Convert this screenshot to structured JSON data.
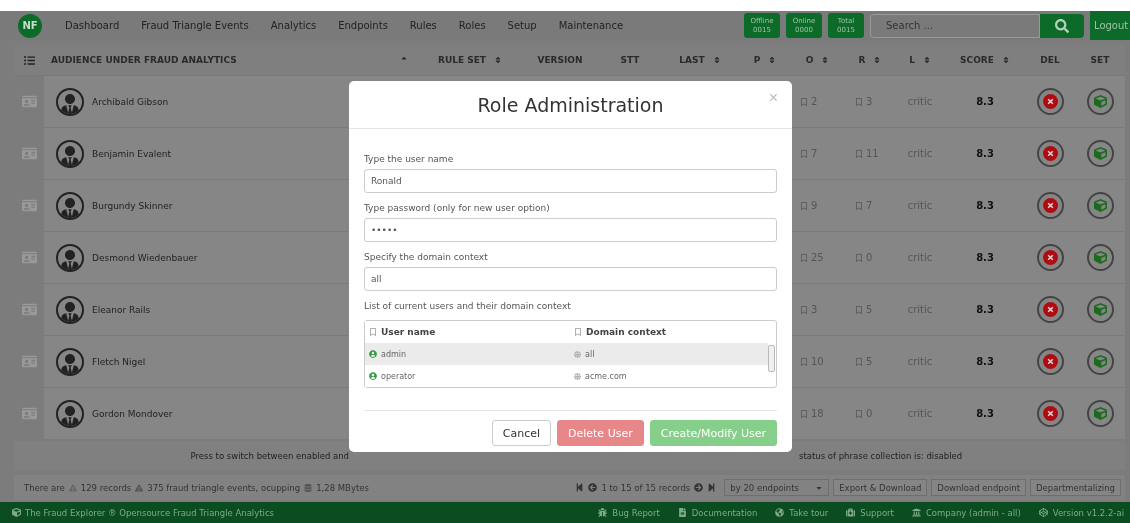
{
  "nav": {
    "logo": "NF",
    "items": [
      "Dashboard",
      "Fraud Triangle Events",
      "Analytics",
      "Endpoints",
      "Rules",
      "Roles",
      "Setup",
      "Maintenance"
    ],
    "counters": [
      {
        "label": "Offline",
        "value": "0015"
      },
      {
        "label": "Online",
        "value": "0000"
      },
      {
        "label": "Total",
        "value": "0015"
      }
    ],
    "search": {
      "placeholder": "Search ..."
    },
    "logout": "Logout"
  },
  "table": {
    "columns": [
      {
        "kind": "list"
      },
      {
        "label": "AUDIENCE UNDER FRAUD ANALYTICS",
        "kind": "sorted"
      },
      {
        "label": "RULE SET",
        "kind": "sortable"
      },
      {
        "label": "VERSION",
        "kind": "plain"
      },
      {
        "label": "STT",
        "kind": "plain"
      },
      {
        "label": "LAST",
        "kind": "sortable"
      },
      {
        "label": "P",
        "kind": "sortable"
      },
      {
        "label": "O",
        "kind": "sortable"
      },
      {
        "label": "R",
        "kind": "sortable"
      },
      {
        "label": "L",
        "kind": "sortable"
      },
      {
        "label": "SCORE",
        "kind": "sortable"
      },
      {
        "label": "DEL",
        "kind": "plain"
      },
      {
        "label": "SET",
        "kind": "plain"
      }
    ],
    "rows": [
      {
        "name": "Archibald Gibson",
        "o": "2",
        "r": "3",
        "l": "critic",
        "score": "8.3"
      },
      {
        "name": "Benjamin Evalent",
        "o": "7",
        "r": "11",
        "l": "critic",
        "score": "8.3"
      },
      {
        "name": "Burgundy Skinner",
        "o": "9",
        "r": "7",
        "l": "critic",
        "score": "8.3"
      },
      {
        "name": "Desmond Wiedenbauer",
        "o": "25",
        "r": "0",
        "l": "critic",
        "score": "8.3"
      },
      {
        "name": "Eleanor Rails",
        "o": "3",
        "r": "5",
        "l": "critic",
        "score": "8.3"
      },
      {
        "name": "Fletch Nigel",
        "o": "10",
        "r": "5",
        "l": "critic",
        "score": "8.3"
      },
      {
        "name": "Gordon Mondover",
        "o": "18",
        "r": "0",
        "l": "critic",
        "score": "8.3"
      }
    ]
  },
  "hint": {
    "left": "Press to switch between enabled and",
    "right": "status of phrase collection is: disabled"
  },
  "status": {
    "prefix": "There are",
    "records": "129 records",
    "events": "375 fraud triangle events, ocupping",
    "size": "1,28 MBytes",
    "pager": "1 to 15 of 15 records",
    "per_page": "by 20 endpoints",
    "buttons": [
      "Export & Download",
      "Download endpoint",
      "Departmentalizing"
    ]
  },
  "footer": {
    "brand": "The Fraud Explorer ® Opensource Fraud Triangle Analytics",
    "links": [
      {
        "kind": "bug",
        "label": "Bug Report"
      },
      {
        "kind": "doc",
        "label": "Documentation"
      },
      {
        "kind": "tour",
        "label": "Take tour"
      },
      {
        "kind": "support",
        "label": "Support"
      },
      {
        "kind": "company",
        "label": "Company (admin - all)"
      },
      {
        "kind": "version",
        "label": "Version v1.2.2-ai"
      }
    ]
  },
  "modal": {
    "title": "Role Administration",
    "close": "×",
    "fields": [
      {
        "label": "Type the user name",
        "value": "Ronald"
      },
      {
        "label": "Type password (only for new user option)",
        "value": "•••••"
      },
      {
        "label": "Specify the domain context",
        "value": "all"
      }
    ],
    "list_label": "List of current users and their domain context",
    "list_columns": [
      "User name",
      "Domain context"
    ],
    "users": [
      {
        "name": "admin",
        "domain": "all",
        "selected": true
      },
      {
        "name": "operator",
        "domain": "acme.com",
        "selected": false
      }
    ],
    "buttons": [
      {
        "kind": "cancel",
        "label": "Cancel"
      },
      {
        "kind": "delete",
        "label": "Delete User"
      },
      {
        "kind": "create",
        "label": "Create/Modify User"
      }
    ]
  }
}
